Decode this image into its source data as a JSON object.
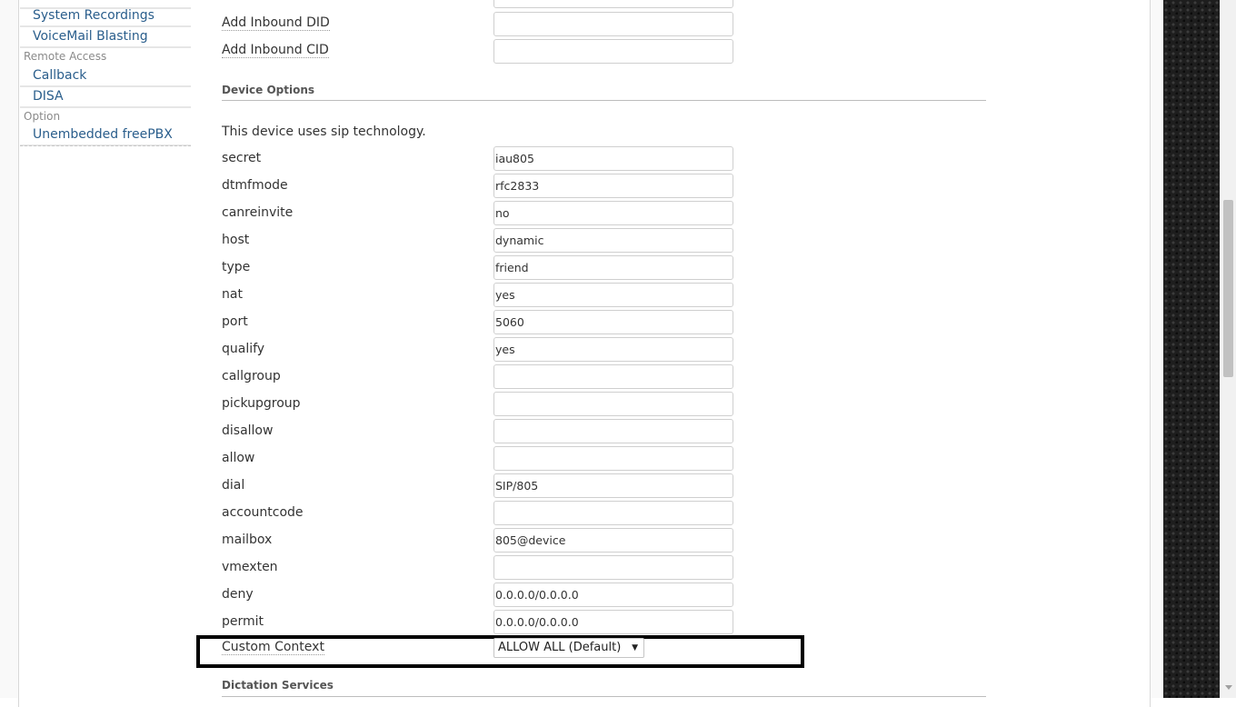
{
  "sidebar": {
    "items_top": [
      "System Recordings",
      "VoiceMail Blasting"
    ],
    "sections": [
      {
        "title": "Remote Access",
        "items": [
          "Callback",
          "DISA"
        ]
      },
      {
        "title": "Option",
        "items": [
          "Unembedded freePBX"
        ]
      }
    ]
  },
  "form": {
    "top_fields": [
      {
        "label": "Add Inbound DID",
        "value": ""
      },
      {
        "label": "Add Inbound CID",
        "value": ""
      }
    ],
    "device_options": {
      "title": "Device Options",
      "info": "This device uses sip technology.",
      "fields": [
        {
          "label": "secret",
          "value": "iau805"
        },
        {
          "label": "dtmfmode",
          "value": "rfc2833"
        },
        {
          "label": "canreinvite",
          "value": "no"
        },
        {
          "label": "host",
          "value": "dynamic"
        },
        {
          "label": "type",
          "value": "friend"
        },
        {
          "label": "nat",
          "value": "yes"
        },
        {
          "label": "port",
          "value": "5060"
        },
        {
          "label": "qualify",
          "value": "yes"
        },
        {
          "label": "callgroup",
          "value": ""
        },
        {
          "label": "pickupgroup",
          "value": ""
        },
        {
          "label": "disallow",
          "value": ""
        },
        {
          "label": "allow",
          "value": ""
        },
        {
          "label": "dial",
          "value": "SIP/805"
        },
        {
          "label": "accountcode",
          "value": ""
        },
        {
          "label": "mailbox",
          "value": "805@device"
        },
        {
          "label": "vmexten",
          "value": ""
        },
        {
          "label": "deny",
          "value": "0.0.0.0/0.0.0.0"
        },
        {
          "label": "permit",
          "value": "0.0.0.0/0.0.0.0"
        }
      ]
    },
    "custom_context": {
      "label": "Custom Context",
      "selected": "ALLOW ALL (Default)"
    },
    "dictation": {
      "title": "Dictation Services"
    }
  }
}
